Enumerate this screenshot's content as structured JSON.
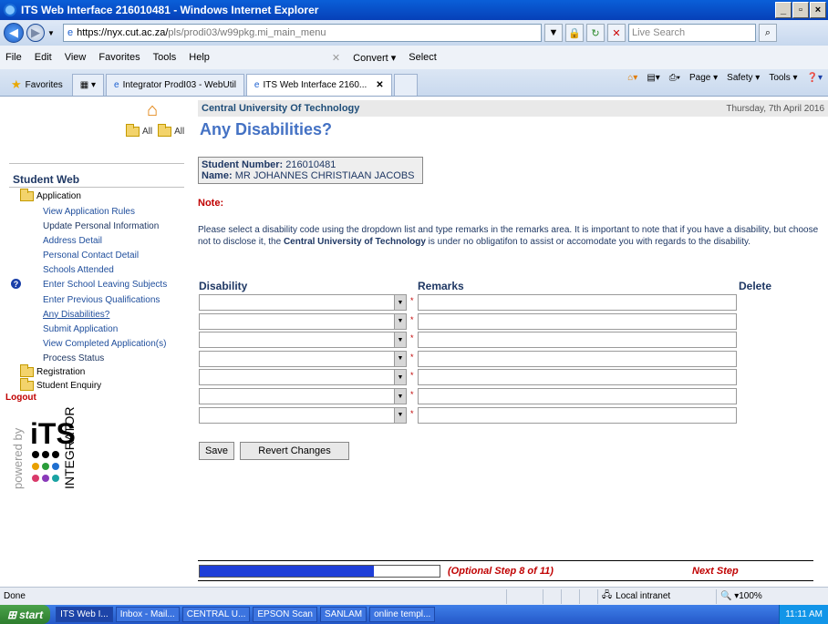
{
  "window": {
    "title": "ITS Web Interface 216010481 - Windows Internet Explorer"
  },
  "address": {
    "url_proto": "https://nyx.cut.ac.za/",
    "url_rest": "pls/prodi03/w99pkg.mi_main_menu",
    "search_placeholder": "Live Search"
  },
  "menu": [
    "File",
    "Edit",
    "View",
    "Favorites",
    "Tools",
    "Help"
  ],
  "menu_extra": {
    "convert": "Convert",
    "select": "Select"
  },
  "tabs": {
    "favorites": "Favorites",
    "tab1": "Integrator ProdI03 - WebUtil",
    "tab2": "ITS Web Interface 2160..."
  },
  "cmd": {
    "page": "Page",
    "safety": "Safety",
    "tools": "Tools"
  },
  "sidebar": {
    "all1": "All",
    "all2": "All",
    "title": "Student Web",
    "application": "Application",
    "items": [
      "View Application Rules",
      "Update Personal Information",
      "Address Detail",
      "Personal Contact Detail",
      "Schools Attended",
      "Enter School Leaving Subjects",
      "Enter Previous Qualifications",
      "Any Disabilities?",
      "Submit Application",
      "View Completed Application(s)",
      "Process Status"
    ],
    "registration": "Registration",
    "enquiry": "Student Enquiry",
    "logout": "Logout",
    "powered": "powered by",
    "brand": "iTS",
    "brand_sub": "INTEGRATOR"
  },
  "main": {
    "institution": "Central University Of Technology",
    "date": "Thursday, 7th April 2016",
    "title": "Any Disabilities?",
    "student_number_label": "Student Number:",
    "student_number": "216010481",
    "name_label": "Name:",
    "name": "MR JOHANNES CHRISTIAAN JACOBS",
    "note": "Note:",
    "para1": "Please select a disability code using the dropdown list and type remarks in the remarks area. It is important to note that if you have a disability, but choose not to disclose it, the ",
    "para_bold": "Central University of Technology",
    "para2": " is under no obligatifon to assist or accomodate you with regards to the disability.",
    "col_disability": "Disability",
    "col_remarks": "Remarks",
    "col_delete": "Delete",
    "rows": 7,
    "save": "Save",
    "revert": "Revert Changes",
    "progress_fraction": 0.727,
    "step_text": "(Optional Step 8 of 11)",
    "next_step": "Next Step"
  },
  "status": {
    "done": "Done",
    "zone": "Local intranet",
    "zoom": "100%"
  },
  "taskbar": {
    "start": "start",
    "items": [
      "ITS Web I...",
      "Inbox - Mail...",
      "CENTRAL U...",
      "EPSON Scan",
      "SANLAM",
      "online templ..."
    ],
    "time": "11:11 AM"
  }
}
